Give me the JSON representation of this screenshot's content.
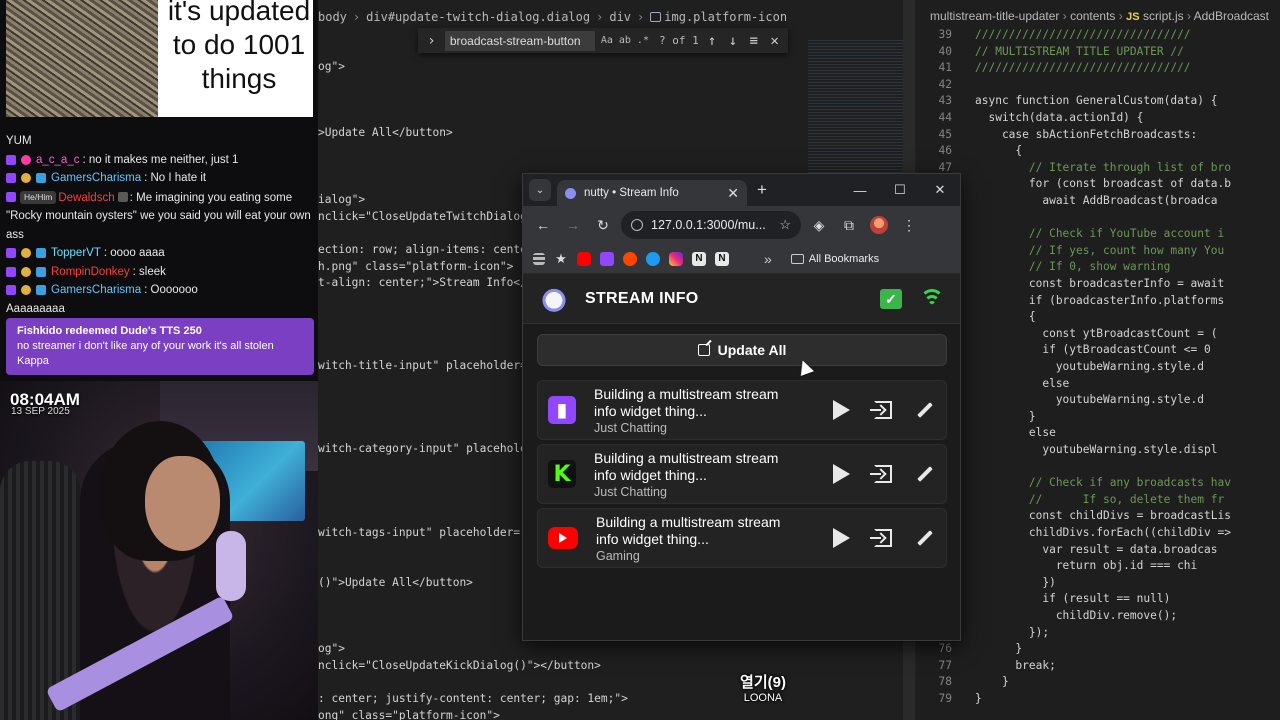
{
  "meme": {
    "text": "it's updated to do 1001 things"
  },
  "chat": {
    "messages": [
      {
        "user": "",
        "text": "YUM"
      },
      {
        "user": "a_c_a_c",
        "text": ": no it makes me neither, just 1"
      },
      {
        "user": "GamersCharisma",
        "text": ": No I hate it"
      },
      {
        "pronoun": "He/Him",
        "user": "Dewaldsch",
        "text": ": Me imagining you eating some \"Rocky mountain oysters\" we you said you will eat your own ass"
      },
      {
        "user": "TopperVT",
        "text": ": oooo aaaa"
      },
      {
        "user": "RompinDonkey",
        "text": ": sleek"
      },
      {
        "user": "GamersCharisma",
        "text": ": Ooooooo"
      },
      {
        "user": "",
        "text": "Aaaaaaaaa"
      }
    ],
    "redeem": {
      "title": "Fishkido redeemed",
      "reward": "Dude's TTS",
      "cost": "250",
      "message": "no streamer i don't like any of your work it's all stolen Kappa"
    }
  },
  "overlay": {
    "time": "08:04AM",
    "date": "13 SEP 2025"
  },
  "editor": {
    "breadcrumb": [
      "body",
      "div#update-twitch-dialog.dialog",
      "div",
      "img.platform-icon"
    ],
    "find": {
      "query": "broadcast-stream-button",
      "opt1": "Aa",
      "opt2": "ab",
      "opt3": ".*",
      "count": "? of 1"
    },
    "left_lines": [
      "og\">",
      ">Update All</button>",
      "ialog\">",
      "nclick=\"CloseUpdateTwitchDialog",
      "ection: row; align-items: center",
      "h.png\" class=\"platform-icon\">",
      "t-align: center;\">Stream Info</",
      "witch-title-input\" placeholder=\"",
      "witch-category-input\" placeholder",
      "witch-tags-input\" placeholder=\"",
      "()\">Update All</button>",
      "og\">",
      "nclick=\"CloseUpdateKickDialog()\"></button>",
      ": center; justify-content: center; gap: 1em;\">",
      "ong\" class=\"platform-icon\">"
    ],
    "right_breadcrumb": [
      "multistream-title-updater",
      "contents",
      "JS",
      "script.js",
      "AddBroadcast"
    ],
    "right_lines": [
      {
        "n": "39",
        "t": "////////////////////////////////"
      },
      {
        "n": "40",
        "t": "// MULTISTREAM TITLE UPDATER //"
      },
      {
        "n": "41",
        "t": "////////////////////////////////"
      },
      {
        "n": "42",
        "t": ""
      },
      {
        "n": "43",
        "t": "async function GeneralCustom(data) {"
      },
      {
        "n": "44",
        "t": "  switch(data.actionId) {"
      },
      {
        "n": "45",
        "t": "    case sbActionFetchBroadcasts:"
      },
      {
        "n": "46",
        "t": "      {"
      },
      {
        "n": "47",
        "t": "        // Iterate through list of bro"
      },
      {
        "n": "48",
        "t": "        for (const broadcast of data.b"
      },
      {
        "n": "49",
        "t": "          await AddBroadcast(broadca"
      },
      {
        "n": "50",
        "t": ""
      },
      {
        "n": "51",
        "t": "        // Check if YouTube account i"
      },
      {
        "n": "52",
        "t": "        // If yes, count how many You"
      },
      {
        "n": "53",
        "t": "        // If 0, show warning"
      },
      {
        "n": "54",
        "t": "        const broadcasterInfo = await"
      },
      {
        "n": "55",
        "t": "        if (broadcasterInfo.platforms"
      },
      {
        "n": "56",
        "t": "        {"
      },
      {
        "n": "57",
        "t": "          const ytBroadcastCount = ("
      },
      {
        "n": "58",
        "t": "          if (ytBroadcastCount <= 0"
      },
      {
        "n": "59",
        "t": "            youtubeWarning.style.d"
      },
      {
        "n": "60",
        "t": "          else"
      },
      {
        "n": "61",
        "t": "            youtubeWarning.style.d"
      },
      {
        "n": "62",
        "t": "        }"
      },
      {
        "n": "63",
        "t": "        else"
      },
      {
        "n": "64",
        "t": "          youtubeWarning.style.displ"
      },
      {
        "n": "65",
        "t": ""
      },
      {
        "n": "66",
        "t": "        // Check if any broadcasts hav"
      },
      {
        "n": "67",
        "t": "        //      If so, delete them fr"
      },
      {
        "n": "68",
        "t": "        const childDivs = broadcastLis"
      },
      {
        "n": "69",
        "t": "        childDivs.forEach((childDiv =>"
      },
      {
        "n": "70",
        "t": "          var result = data.broadcas"
      },
      {
        "n": "71",
        "t": "            return obj.id === chi"
      },
      {
        "n": "72",
        "t": "          })"
      },
      {
        "n": "73",
        "t": "          if (result == null)"
      },
      {
        "n": "74",
        "t": "            childDiv.remove();"
      },
      {
        "n": "75",
        "t": "        });"
      },
      {
        "n": "76",
        "t": "      }"
      },
      {
        "n": "77",
        "t": "      break;"
      },
      {
        "n": "78",
        "t": "    }"
      },
      {
        "n": "79",
        "t": "}"
      }
    ],
    "subtitle": {
      "title": "열기(9)",
      "artist": "LOONA"
    }
  },
  "browser": {
    "tab_title": "nutty • Stream Info",
    "url": "127.0.0.1:3000/mu...",
    "bookmarks_label": "All Bookmarks",
    "bookmark_icons": [
      "youtube-icon",
      "twitch-icon",
      "reddit-icon",
      "twitter-icon",
      "instagram-icon",
      "notion-icon",
      "notion-icon"
    ]
  },
  "app": {
    "title": "STREAM INFO",
    "update_all": "Update All",
    "colors": {
      "twitch": "#9146ff",
      "kick": "#53fc18",
      "youtube": "#ff0000",
      "status_green": "#3cb54a"
    },
    "rows": [
      {
        "platform": "twitch",
        "title_line1": "Building a multistream stream",
        "title_line2": "info widget thing...",
        "category": "Just Chatting"
      },
      {
        "platform": "kick",
        "title_line1": "Building a multistream stream",
        "title_line2": "info widget thing...",
        "category": "Just Chatting"
      },
      {
        "platform": "youtube",
        "title_line1": "Building a multistream stream",
        "title_line2": "info widget thing...",
        "category": "Gaming"
      }
    ]
  }
}
